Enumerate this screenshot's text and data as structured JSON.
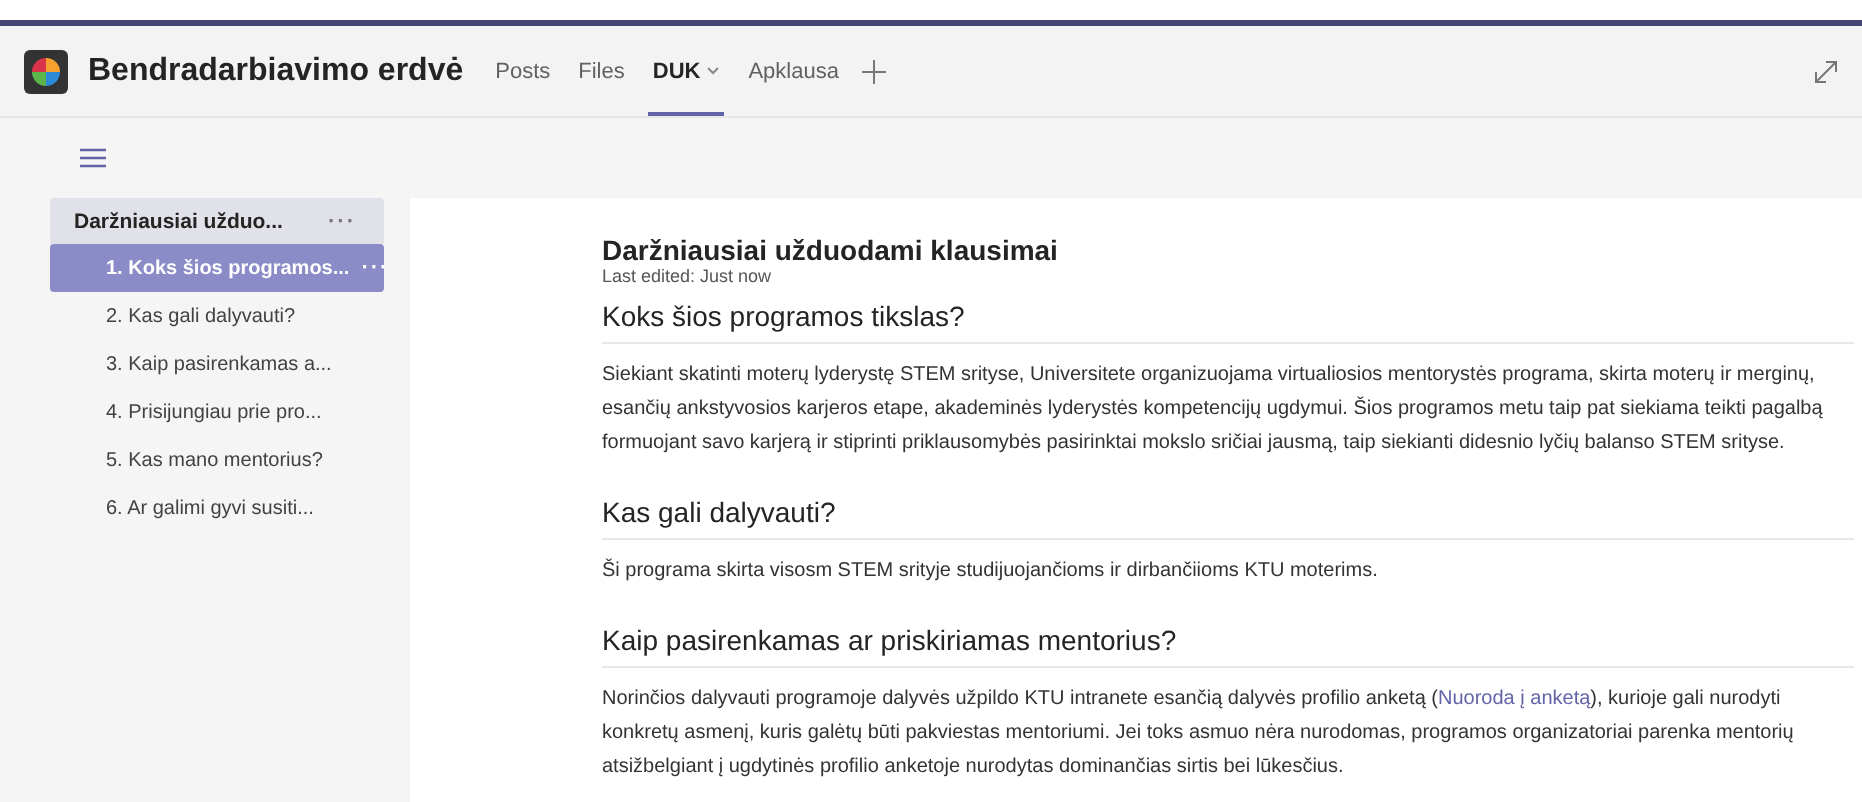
{
  "header": {
    "title": "Bendradarbiavimo erdvė",
    "tabs": [
      {
        "label": "Posts",
        "selected": false,
        "dropdown": false
      },
      {
        "label": "Files",
        "selected": false,
        "dropdown": false
      },
      {
        "label": "DUK",
        "selected": true,
        "dropdown": true
      },
      {
        "label": "Apklausa",
        "selected": false,
        "dropdown": false
      }
    ]
  },
  "sidebar": {
    "section": {
      "label": "Daržniausiai užduo...",
      "more": "···"
    },
    "items": [
      {
        "label": "1. Koks šios programos...",
        "selected": true,
        "more": "···"
      },
      {
        "label": "2. Kas gali dalyvauti?",
        "selected": false
      },
      {
        "label": "3. Kaip pasirenkamas a...",
        "selected": false
      },
      {
        "label": "4. Prisijungiau prie pro...",
        "selected": false
      },
      {
        "label": "5. Kas mano mentorius?",
        "selected": false
      },
      {
        "label": "6. Ar galimi gyvi susiti...",
        "selected": false
      }
    ]
  },
  "page": {
    "title": "Daržniausiai užduodami klausimai",
    "last_edited": "Last edited: Just now",
    "sections": [
      {
        "heading": "Koks šios programos tikslas?",
        "segments": [
          {
            "kind": "text",
            "text": "Siekiant skatinti moterų lyderystę STEM srityse, Universitete organizuojama virtualiosios mentorystės programa, skirta moterų ir merginų, esančių ankstyvosios karjeros etape, akademinės lyderystės kompetencijų ugdymui. Šios programos metu taip pat siekiama teikti pagalbą formuojant savo karjerą ir stiprinti priklausomybės pasirinktai mokslo sričiai jausmą, taip siekianti didesnio lyčių balanso STEM srityse."
          }
        ]
      },
      {
        "heading": "Kas gali dalyvauti?",
        "segments": [
          {
            "kind": "text",
            "text": "Ši programa skirta visosm STEM srityje studijuojančioms ir dirbančiioms KTU moterims."
          }
        ]
      },
      {
        "heading": "Kaip pasirenkamas ar priskiriamas mentorius?",
        "segments": [
          {
            "kind": "text",
            "text": "Norinčios dalyvauti programoje dalyvės užpildo KTU intranete esančią dalyvės profilio anketą ("
          },
          {
            "kind": "link",
            "text": "Nuoroda į anketą"
          },
          {
            "kind": "text",
            "text": "), kurioje gali nurodyti konkretų asmenį, kuris galėtų būti pakviestas mentoriumi. Jei toks asmuo nėra nurodomas, programos organizatoriai parenka mentorių atsižbelgiant į ugdytinės profilio anketoje nurodytas dominančias sirtis bei lūkesčius."
          }
        ]
      }
    ]
  }
}
